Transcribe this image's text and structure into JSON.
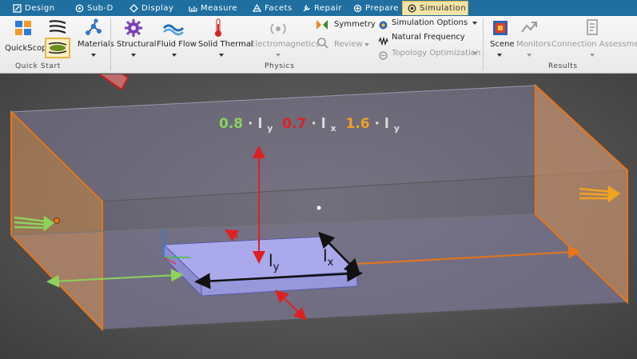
{
  "tabs": [
    {
      "label": "Design",
      "icon": "design-icon"
    },
    {
      "label": "Sub-D",
      "icon": "subd-icon"
    },
    {
      "label": "Display",
      "icon": "display-icon"
    },
    {
      "label": "Measure",
      "icon": "measure-icon"
    },
    {
      "label": "Facets",
      "icon": "facets-icon"
    },
    {
      "label": "Repair",
      "icon": "repair-icon"
    },
    {
      "label": "Prepare",
      "icon": "prepare-icon"
    },
    {
      "label": "Simulation",
      "icon": "simulation-icon",
      "active": true
    }
  ],
  "ribbon": {
    "quickscope": "QuickScope",
    "materials": "Materials",
    "structural": "Structural",
    "fluid_flow": "Fluid Flow",
    "solid_thermal": "Solid Thermal",
    "electromagnetics": "Electromagnetics",
    "symmetry": "Symmetry",
    "review": "Review",
    "simulation_options": "Simulation Options",
    "natural_frequency": "Natural Frequency",
    "topology_optimization": "Topology Optimization",
    "scene": "Scene",
    "monitors": "Monitors",
    "connection_assessment": "Connection Assessment",
    "groups": {
      "quick_start": "Quick Start",
      "physics": "Physics",
      "results": "Results"
    }
  },
  "viewport": {
    "dimension_labels": {
      "height_coef": "0.8",
      "lateral_coef": "0.7",
      "length_coef": "1.6",
      "dot": "·",
      "l": "l",
      "y": "y",
      "x": "x"
    },
    "plate_labels": {
      "ly": "l",
      "ly_sub": "y",
      "lx": "l",
      "lx_sub": "x"
    },
    "colors": {
      "green": "#8bd35a",
      "red": "#e02020",
      "orange": "#f2a21e",
      "domain_edge": "#e8751a",
      "plate": "#a9a9ec",
      "tab_active": "#f3e3a6",
      "ribbon_highlight": "#e4b93f"
    }
  }
}
